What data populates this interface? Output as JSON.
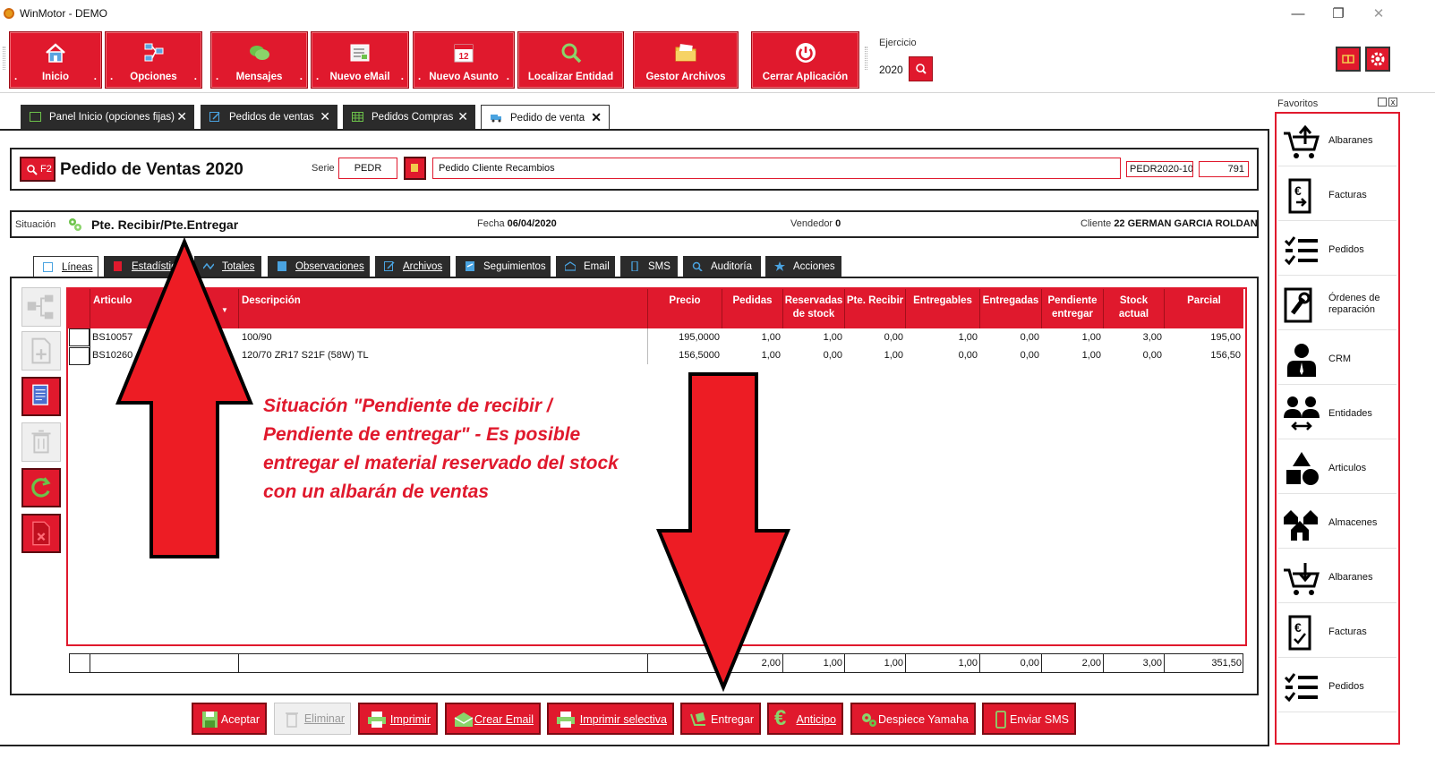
{
  "window": {
    "title": "WinMotor - DEMO",
    "minimize": "—",
    "maximize": "❐",
    "close": "✕"
  },
  "ribbon": {
    "buttons": [
      {
        "label": "Inicio",
        "icon": "home-icon"
      },
      {
        "label": "Opciones",
        "icon": "options-icon"
      },
      {
        "label": "Mensajes",
        "icon": "chat-icon"
      },
      {
        "label": "Nuevo eMail",
        "icon": "email-icon"
      },
      {
        "label": "Nuevo Asunto",
        "icon": "calendar-icon"
      },
      {
        "label": "Localizar Entidad",
        "icon": "search-icon"
      },
      {
        "label": "Gestor Archivos",
        "icon": "folder-icon"
      },
      {
        "label": "Cerrar Aplicación",
        "icon": "power-icon"
      }
    ],
    "dot": ".",
    "ejercicio_label": "Ejercicio",
    "ejercicio_value": "2020"
  },
  "doc_tabs": [
    {
      "label": "Panel Inicio (opciones fijas)",
      "close": "✕"
    },
    {
      "label": "Pedidos de ventas",
      "close": "✕"
    },
    {
      "label": "Pedidos Compras",
      "close": "✕"
    },
    {
      "label": "Pedido de venta",
      "close": "✕"
    }
  ],
  "header": {
    "f2_label": "F2",
    "title": "Pedido de Ventas 2020",
    "serie_label": "Serie",
    "serie_value": "PEDR",
    "description": "Pedido Cliente Recambios",
    "doc_code": "PEDR2020-10",
    "doc_number": "791"
  },
  "situation": {
    "label": "Situación",
    "value": "Pte. Recibir/Pte.Entregar",
    "fecha_label": "Fecha",
    "fecha_value": "06/04/2020",
    "vendedor_label": "Vendedor",
    "vendedor_value": "0",
    "cliente_label": "Cliente",
    "cliente_value": "22 GERMAN GARCIA ROLDAN"
  },
  "inner_tabs": [
    {
      "label": "Líneas"
    },
    {
      "label": "Estadísticas"
    },
    {
      "label": "Totales"
    },
    {
      "label": "Observaciones"
    },
    {
      "label": "Archivos"
    },
    {
      "label": "Seguimientos"
    },
    {
      "label": "Email"
    },
    {
      "label": "SMS"
    },
    {
      "label": "Auditoría"
    },
    {
      "label": "Acciones"
    }
  ],
  "grid": {
    "columns": {
      "articulo": "Articulo",
      "descripcion": "Descripción",
      "precio": "Precio",
      "pedidas": "Pedidas",
      "reservadas_1": "Reservadas",
      "reservadas_2": "de stock",
      "pte_recibir": "Pte. Recibir",
      "entregables": "Entregables",
      "entregadas": "Entregadas",
      "pendiente_1": "Pendiente",
      "pendiente_2": "entregar",
      "stock_1": "Stock",
      "stock_2": "actual",
      "parcial": "Parcial"
    },
    "rows": [
      {
        "articulo": "BS10057",
        "descripcion": "100/90",
        "precio": "195,0000",
        "pedidas": "1,00",
        "reservadas": "1,00",
        "pte_recibir": "0,00",
        "entregables": "1,00",
        "entregadas": "0,00",
        "pendiente": "1,00",
        "stock": "3,00",
        "parcial": "195,00"
      },
      {
        "articulo": "BS10260",
        "descripcion": "120/70 ZR17 S21F (58W) TL",
        "precio": "156,5000",
        "pedidas": "1,00",
        "reservadas": "0,00",
        "pte_recibir": "1,00",
        "entregables": "0,00",
        "entregadas": "0,00",
        "pendiente": "1,00",
        "stock": "0,00",
        "parcial": "156,50"
      }
    ],
    "totals": {
      "pedidas": "2,00",
      "reservadas": "1,00",
      "pte_recibir": "1,00",
      "entregables": "1,00",
      "entregadas": "0,00",
      "pendiente": "2,00",
      "stock": "3,00",
      "parcial": "351,50"
    }
  },
  "annotation": {
    "line1": "Situación \"Pendiente de recibir /",
    "line2": "Pendiente de entregar\" - Es posible",
    "line3": "entregar el material reservado del stock",
    "line4": "con un albarán de ventas"
  },
  "bottom_buttons": [
    {
      "label": "Aceptar",
      "enabled": true
    },
    {
      "label": "Eliminar",
      "enabled": false
    },
    {
      "label": "Imprimir",
      "enabled": true
    },
    {
      "label": "Crear Email",
      "enabled": true
    },
    {
      "label": "Imprimir selectiva",
      "enabled": true
    },
    {
      "label": "Entregar",
      "enabled": true
    },
    {
      "label": "Anticipo",
      "enabled": true
    },
    {
      "label": "Despiece Yamaha",
      "enabled": true
    },
    {
      "label": "Enviar SMS",
      "enabled": true
    }
  ],
  "favorites": {
    "title": "Favoritos",
    "items": [
      {
        "label": "Albaranes",
        "icon": "cart-upload-icon"
      },
      {
        "label": "Facturas",
        "icon": "invoice-euro-icon"
      },
      {
        "label": "Pedidos",
        "icon": "checklist-icon"
      },
      {
        "label": "Órdenes de reparación",
        "icon": "wrench-icon"
      },
      {
        "label": "CRM",
        "icon": "person-icon"
      },
      {
        "label": "Entidades",
        "icon": "people-exchange-icon"
      },
      {
        "label": "Articulos",
        "icon": "shapes-icon"
      },
      {
        "label": "Almacenes",
        "icon": "houses-icon"
      },
      {
        "label": "Albaranes",
        "icon": "cart-download-icon"
      },
      {
        "label": "Facturas",
        "icon": "invoice-check-icon"
      },
      {
        "label": "Pedidos",
        "icon": "checklist-icon"
      }
    ]
  },
  "colors": {
    "accent_red": "#e0192d",
    "dark_tab": "#2b2b2b"
  }
}
